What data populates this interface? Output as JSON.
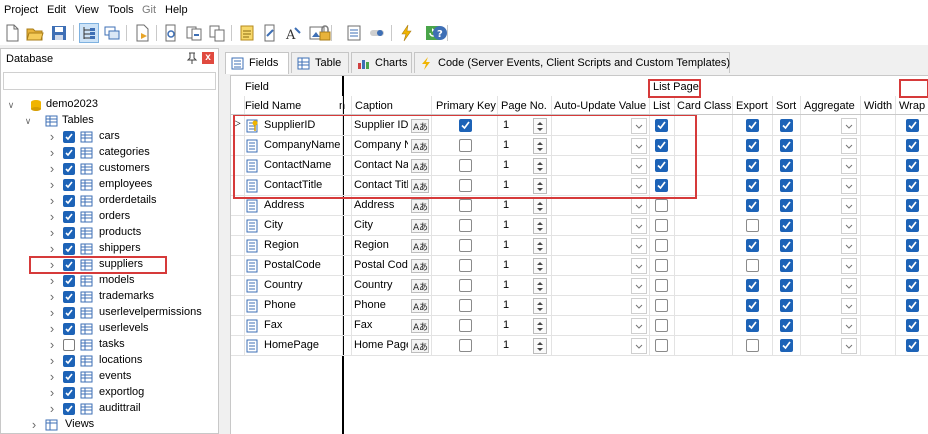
{
  "menubar": {
    "items": [
      "Project",
      "Edit",
      "View",
      "Tools",
      "Git",
      "Help"
    ]
  },
  "sidebar": {
    "title": "Database",
    "close_label": "x",
    "search_value": "",
    "project": "demo2023",
    "tables_label": "Tables",
    "tables": [
      {
        "name": "cars",
        "checked": true
      },
      {
        "name": "categories",
        "checked": true
      },
      {
        "name": "customers",
        "checked": true
      },
      {
        "name": "employees",
        "checked": true
      },
      {
        "name": "orderdetails",
        "checked": true
      },
      {
        "name": "orders",
        "checked": true
      },
      {
        "name": "products",
        "checked": true
      },
      {
        "name": "shippers",
        "checked": true
      },
      {
        "name": "suppliers",
        "checked": true,
        "selected": true
      },
      {
        "name": "models",
        "checked": true
      },
      {
        "name": "trademarks",
        "checked": true
      },
      {
        "name": "userlevelpermissions",
        "checked": true
      },
      {
        "name": "userlevels",
        "checked": true
      },
      {
        "name": "tasks",
        "checked": false
      },
      {
        "name": "locations",
        "checked": true
      },
      {
        "name": "events",
        "checked": true
      },
      {
        "name": "exportlog",
        "checked": true
      },
      {
        "name": "audittrail",
        "checked": true
      }
    ],
    "views_label": "Views"
  },
  "tabs": [
    {
      "label": "Fields",
      "icon": "fields-icon",
      "active": true
    },
    {
      "label": "Table",
      "icon": "table-icon",
      "active": false
    },
    {
      "label": "Charts",
      "icon": "chart-icon",
      "active": false
    },
    {
      "label": "Code (Server Events, Client Scripts and Custom Templates)",
      "icon": "lightning-icon",
      "active": false
    }
  ],
  "grid": {
    "group_field": "Field",
    "group_list_page": "List Page",
    "columns": {
      "field_name": "Field Name",
      "n": "n",
      "caption": "Caption",
      "primary_key": "Primary Key",
      "page_no": "Page No.",
      "auto_update": "Auto-Update Value",
      "list": "List",
      "card_class": "Card Class",
      "export": "Export",
      "sort": "Sort",
      "aggregate": "Aggregate",
      "width": "Width",
      "wrap": "Wrap"
    },
    "rows": [
      {
        "field": "SupplierID",
        "caption": "Supplier ID",
        "pk": true,
        "page": "1",
        "list": true,
        "export": true,
        "sort": true,
        "wrap": true,
        "key": true
      },
      {
        "field": "CompanyName",
        "caption": "Company N",
        "pk": false,
        "page": "1",
        "list": true,
        "export": true,
        "sort": true,
        "wrap": true
      },
      {
        "field": "ContactName",
        "caption": "Contact Nar",
        "pk": false,
        "page": "1",
        "list": true,
        "export": true,
        "sort": true,
        "wrap": true
      },
      {
        "field": "ContactTitle",
        "caption": "Contact Titl",
        "pk": false,
        "page": "1",
        "list": true,
        "export": true,
        "sort": true,
        "wrap": true
      },
      {
        "field": "Address",
        "caption": "Address",
        "pk": false,
        "page": "1",
        "list": false,
        "export": true,
        "sort": true,
        "wrap": true
      },
      {
        "field": "City",
        "caption": "City",
        "pk": false,
        "page": "1",
        "list": false,
        "export": false,
        "sort": true,
        "wrap": true
      },
      {
        "field": "Region",
        "caption": "Region",
        "pk": false,
        "page": "1",
        "list": false,
        "export": true,
        "sort": true,
        "wrap": true
      },
      {
        "field": "PostalCode",
        "caption": "Postal Code",
        "pk": false,
        "page": "1",
        "list": false,
        "export": false,
        "sort": true,
        "wrap": true
      },
      {
        "field": "Country",
        "caption": "Country",
        "pk": false,
        "page": "1",
        "list": false,
        "export": true,
        "sort": true,
        "wrap": true
      },
      {
        "field": "Phone",
        "caption": "Phone",
        "pk": false,
        "page": "1",
        "list": false,
        "export": true,
        "sort": true,
        "wrap": true
      },
      {
        "field": "Fax",
        "caption": "Fax",
        "pk": false,
        "page": "1",
        "list": false,
        "export": true,
        "sort": true,
        "wrap": true
      },
      {
        "field": "HomePage",
        "caption": "Home Page",
        "pk": false,
        "page": "1",
        "list": false,
        "export": false,
        "sort": true,
        "wrap": true
      }
    ]
  },
  "colors": {
    "checkbox_checked": "#1d63b7",
    "highlight_border": "#d63a3a",
    "close_button": "#e04a3f"
  }
}
